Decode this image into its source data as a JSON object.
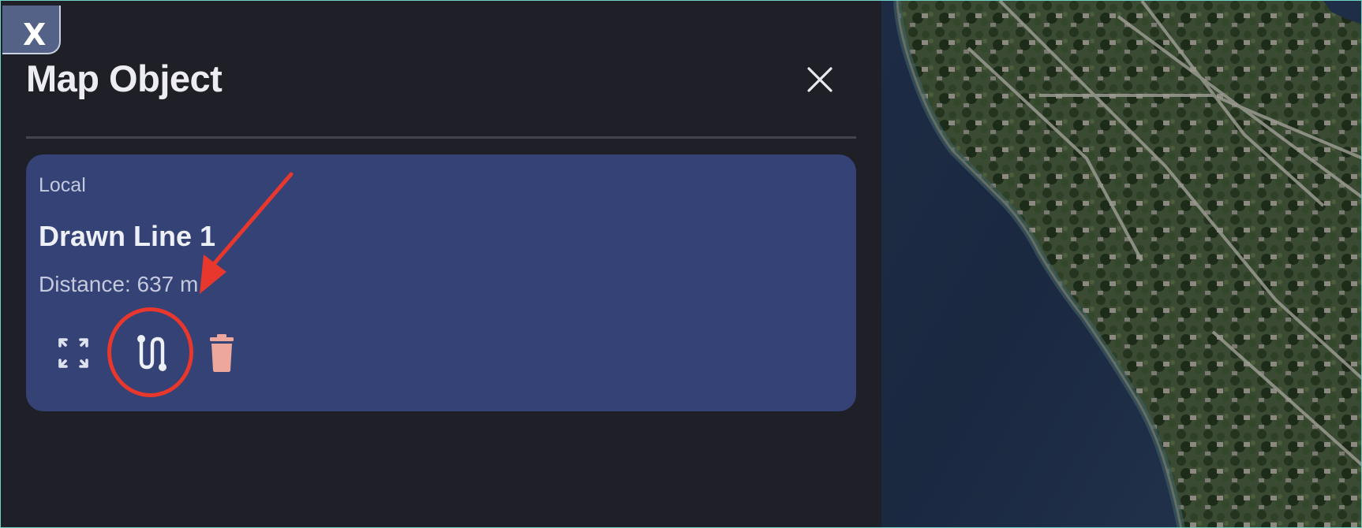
{
  "tab": {
    "close_label": "X"
  },
  "panel": {
    "title": "Map Object",
    "close_icon": "close-icon"
  },
  "map_object": {
    "source": "Local",
    "name": "Drawn Line 1",
    "distance": "Distance: 637 m",
    "actions": [
      {
        "icon": "fullscreen-expand-icon"
      },
      {
        "icon": "route-icon"
      },
      {
        "icon": "trash-icon"
      }
    ]
  },
  "annotation": {
    "color": "#e8372c",
    "highlight_target": "route-icon"
  },
  "colors": {
    "panel_bg": "#1f1f27",
    "card_bg": "#344275",
    "delete_accent": "#eea79c",
    "frame_border": "#6fd3c5"
  }
}
